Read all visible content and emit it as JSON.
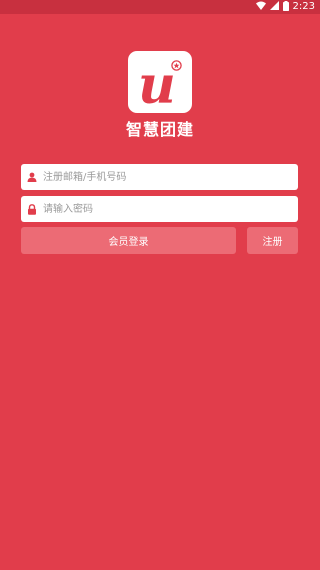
{
  "status_bar": {
    "time": "2:23",
    "icons": [
      "wifi-icon",
      "signal-icon",
      "battery-icon"
    ]
  },
  "logo": {
    "mark": "u",
    "app_name": "智慧团建"
  },
  "login_form": {
    "account_placeholder": "注册邮箱/手机号码",
    "account_value": "",
    "password_placeholder": "请输入密码",
    "password_value": "",
    "login_button": "会员登录",
    "register_button": "注册"
  },
  "colors": {
    "background": "#E13D4B",
    "status_bar": "#C8303F",
    "button": "#EC6B75",
    "field": "#ffffff",
    "icon": "#E13D4B"
  }
}
